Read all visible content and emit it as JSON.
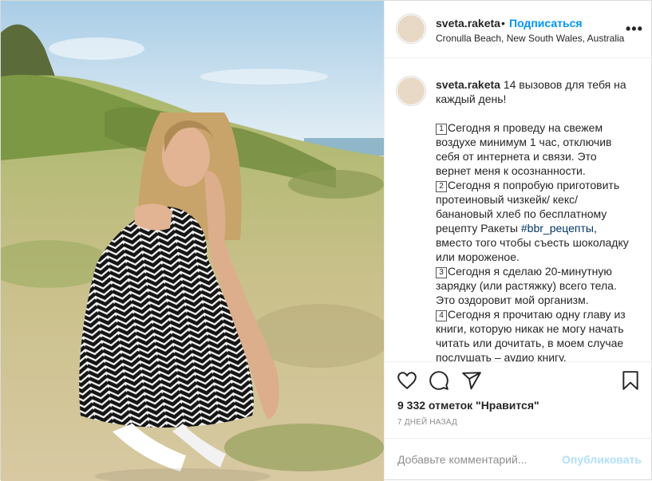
{
  "header": {
    "username": "sveta.raketa",
    "separator": "•",
    "follow_label": "Подписаться",
    "location": "Cronulla Beach, New South Wales, Australia",
    "more_label": "•••"
  },
  "caption": {
    "username": "sveta.raketa",
    "intro": " 14 вызовов для тебя на каждый день!",
    "items": [
      {
        "num": "1",
        "text": "Сегодня я проведу на свежем воздухе минимум 1 час, отключив себя от интернета и связи. Это вернет меня к осознанности."
      },
      {
        "num": "2",
        "text_before": "Сегодня я попробую приготовить протеиновый чизкейк/ кекс/ банановый хлеб по бесплатному рецепту Ракеты ",
        "hashtag": "#bbr_рецепты",
        "text_after": ", вместо того чтобы съесть шоколадку или мороженое."
      },
      {
        "num": "3",
        "text": "Сегодня я сделаю 20-минутную зарядку (или растяжку) всего тела. Это оздоровит мой организм."
      },
      {
        "num": "4",
        "text": "Сегодня я прочитаю одну главу из книги, которую никак не могу начать читать или дочитать, в моем случае послушать – аудио книгу."
      }
    ]
  },
  "actions": {
    "icons": [
      "heart-icon",
      "comment-icon",
      "share-icon",
      "bookmark-icon"
    ],
    "likes": "9 332 отметок \"Нравится\"",
    "date": "7 ДНЕЙ НАЗАД"
  },
  "comment": {
    "placeholder": "Добавьте комментарий...",
    "publish_label": "Опубликовать"
  },
  "colors": {
    "accent": "#0095f6",
    "publish_disabled": "#b2dffc",
    "hashtag": "#00376b",
    "muted": "#8e8e8e"
  }
}
